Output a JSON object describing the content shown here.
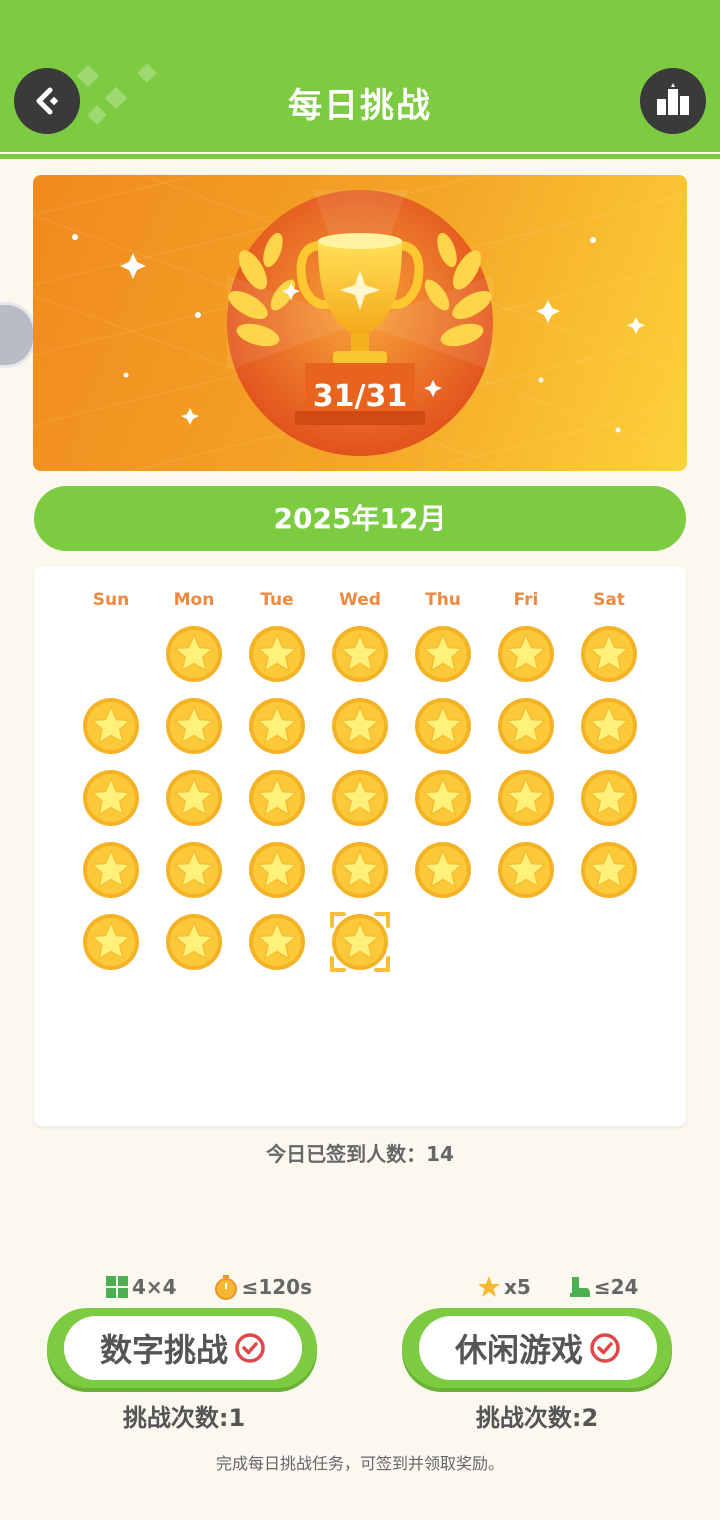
{
  "header": {
    "title": "每日挑战",
    "back_icon": "back-arrow-icon",
    "rank_icon": "leaderboard-icon"
  },
  "banner": {
    "progress": "31/31",
    "icon": "trophy-icon"
  },
  "calendar": {
    "month": "2025年12月",
    "weekdays": [
      "Sun",
      "Mon",
      "Tue",
      "Wed",
      "Thu",
      "Fri",
      "Sat"
    ],
    "first_weekday_index": 1,
    "days_in_month": 31,
    "checked_days": 31,
    "selected_day": 31,
    "coin_color": "#f8c42e"
  },
  "stats": {
    "today_signed_in": "今日已签到人数：14"
  },
  "challenges": [
    {
      "title": "数字挑战",
      "meta1": "4×4",
      "meta2": "≤120s",
      "count": "挑战次数:1"
    },
    {
      "title": "休闲游戏",
      "meta1": "x5",
      "meta2": "≤24",
      "count": "挑战次数:2"
    }
  ],
  "footer": {
    "note": "完成每日挑战任务，可签到并领取奖励。"
  },
  "colors": {
    "primary": "#7ccb41",
    "accent_orange": "#ee8a3f",
    "check_red": "#e04848"
  }
}
